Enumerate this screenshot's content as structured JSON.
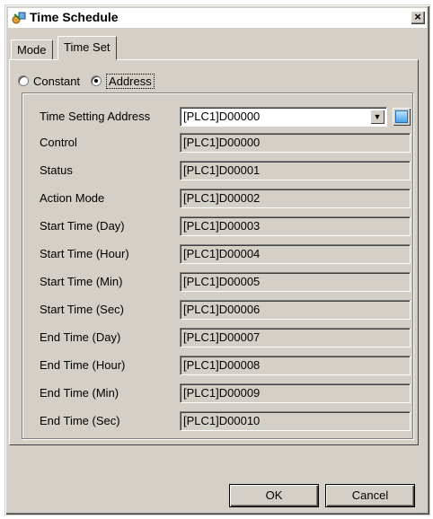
{
  "window": {
    "title": "Time Schedule",
    "close_label": "×"
  },
  "tabs": [
    "Mode",
    "Time Set"
  ],
  "radios": {
    "constant": "Constant",
    "address": "Address"
  },
  "time_setting": {
    "label": "Time Setting Address",
    "value": "[PLC1]D00000"
  },
  "rows": [
    {
      "label": "Control",
      "value": "[PLC1]D00000"
    },
    {
      "label": "Status",
      "value": "[PLC1]D00001"
    },
    {
      "label": "Action Mode",
      "value": "[PLC1]D00002"
    },
    {
      "label": "Start Time (Day)",
      "value": "[PLC1]D00003"
    },
    {
      "label": "Start Time (Hour)",
      "value": "[PLC1]D00004"
    },
    {
      "label": "Start Time (Min)",
      "value": "[PLC1]D00005"
    },
    {
      "label": "Start Time (Sec)",
      "value": "[PLC1]D00006"
    },
    {
      "label": "End Time (Day)",
      "value": "[PLC1]D00007"
    },
    {
      "label": "End Time (Hour)",
      "value": "[PLC1]D00008"
    },
    {
      "label": "End Time (Min)",
      "value": "[PLC1]D00009"
    },
    {
      "label": "End Time (Sec)",
      "value": "[PLC1]D00010"
    }
  ],
  "buttons": {
    "ok": "OK",
    "cancel": "Cancel"
  },
  "colors": {
    "face": "#d4d0c8",
    "address_icon": "#4aa3e6"
  }
}
